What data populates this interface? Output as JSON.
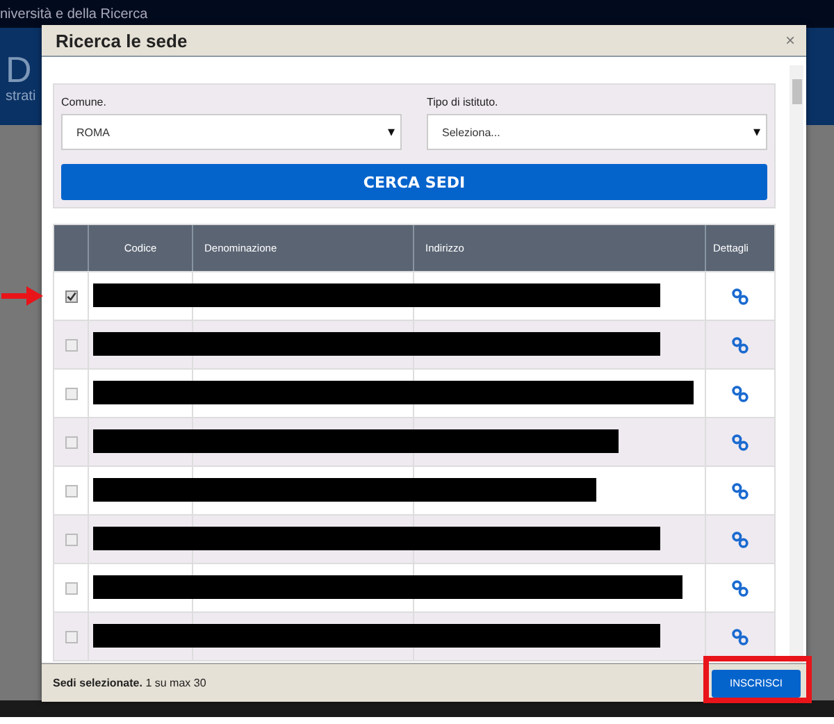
{
  "background": {
    "header_text": "niversità  e della Ricerca",
    "logo_text": "D",
    "subtitle_text": "strati"
  },
  "dialog": {
    "title": "Ricerca le sede",
    "close": "×",
    "filters": [
      {
        "label": "Comune.",
        "value": "ROMA",
        "caret": "▾"
      },
      {
        "label": "Tipo di istituto.",
        "value": "Seleziona...",
        "caret": "▾"
      }
    ],
    "search_button": "CERCA SEDI",
    "table": {
      "columns": [
        "Codice",
        "Denominazione",
        "Indirizzo",
        "Dettagli"
      ],
      "rows": [
        {
          "checked": true,
          "pointed": true
        },
        {
          "checked": false,
          "pointed": false
        },
        {
          "checked": false,
          "pointed": false
        },
        {
          "checked": false,
          "pointed": false
        },
        {
          "checked": false,
          "pointed": false
        },
        {
          "checked": false,
          "pointed": false
        },
        {
          "checked": false,
          "pointed": false
        },
        {
          "checked": false,
          "pointed": false
        }
      ]
    },
    "footer": {
      "label": "Sedi selezionate.",
      "count": "1 su max 30"
    },
    "submit_button": {
      "label": "INSCRISCI",
      "highlighted": true
    }
  }
}
